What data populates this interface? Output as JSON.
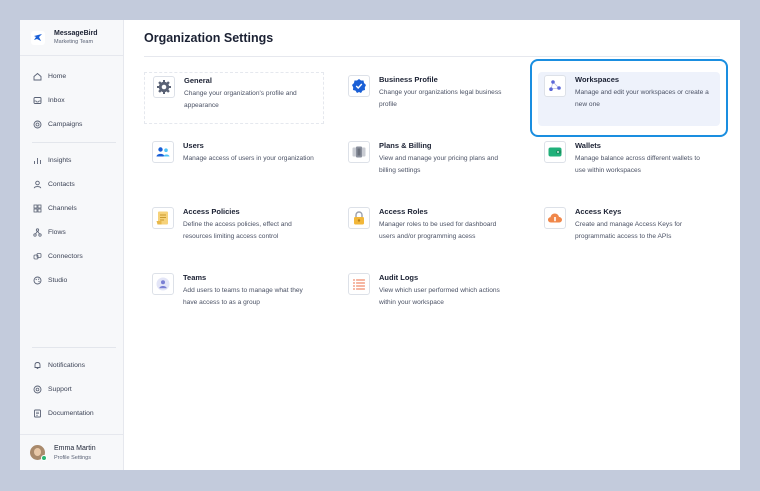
{
  "brand": {
    "name": "MessageBird",
    "team": "Marketing Team",
    "logo_icon": "bird-icon"
  },
  "sidebar": {
    "primary": [
      {
        "label": "Home",
        "icon": "home-icon"
      },
      {
        "label": "Inbox",
        "icon": "inbox-icon"
      },
      {
        "label": "Campaigns",
        "icon": "campaigns-icon"
      }
    ],
    "secondary": [
      {
        "label": "Insights",
        "icon": "insights-icon"
      },
      {
        "label": "Contacts",
        "icon": "contacts-icon"
      },
      {
        "label": "Channels",
        "icon": "channels-icon"
      },
      {
        "label": "Flows",
        "icon": "flows-icon"
      },
      {
        "label": "Connectors",
        "icon": "connectors-icon"
      },
      {
        "label": "Studio",
        "icon": "studio-icon"
      }
    ],
    "bottom": [
      {
        "label": "Notifications",
        "icon": "bell-icon"
      },
      {
        "label": "Support",
        "icon": "support-icon"
      },
      {
        "label": "Documentation",
        "icon": "documentation-icon"
      }
    ]
  },
  "profile": {
    "name": "Emma Martin",
    "subtitle": "Profile Settings"
  },
  "page": {
    "title": "Organization Settings"
  },
  "cards": [
    {
      "title": "General",
      "desc": "Change your organization's profile and appearance",
      "icon": "gear-icon"
    },
    {
      "title": "Business Profile",
      "desc": "Change your organizations legal business profile",
      "icon": "verified-badge-icon"
    },
    {
      "title": "Workspaces",
      "desc": "Manage and edit your workspaces or create a new one",
      "icon": "workspaces-icon"
    },
    {
      "title": "Users",
      "desc": "Manage access of users in your organization",
      "icon": "users-icon"
    },
    {
      "title": "Plans & Billing",
      "desc": "View and manage your pricing plans and billing settings",
      "icon": "billing-icon"
    },
    {
      "title": "Wallets",
      "desc": "Manage balance across different wallets to use within workspaces",
      "icon": "wallet-icon"
    },
    {
      "title": "Access Policies",
      "desc": "Define the access policies, effect and resources limiting access control",
      "icon": "policy-document-icon"
    },
    {
      "title": "Access Roles",
      "desc": "Manager roles to be used for dashboard users and/or programming acess",
      "icon": "lock-icon"
    },
    {
      "title": "Access Keys",
      "desc": "Create and manage Access Keys for programmatic access to the APIs",
      "icon": "cloud-key-icon"
    },
    {
      "title": "Teams",
      "desc": "Add users to teams to manage what they have access to as a group",
      "icon": "team-icon"
    },
    {
      "title": "Audit Logs",
      "desc": "View which user performed which actions within your workspace",
      "icon": "audit-list-icon"
    }
  ],
  "colors": {
    "highlight": "#1a8ee0",
    "highlight_bg": "#eef2fb",
    "backdrop": "#c3cbdc"
  }
}
